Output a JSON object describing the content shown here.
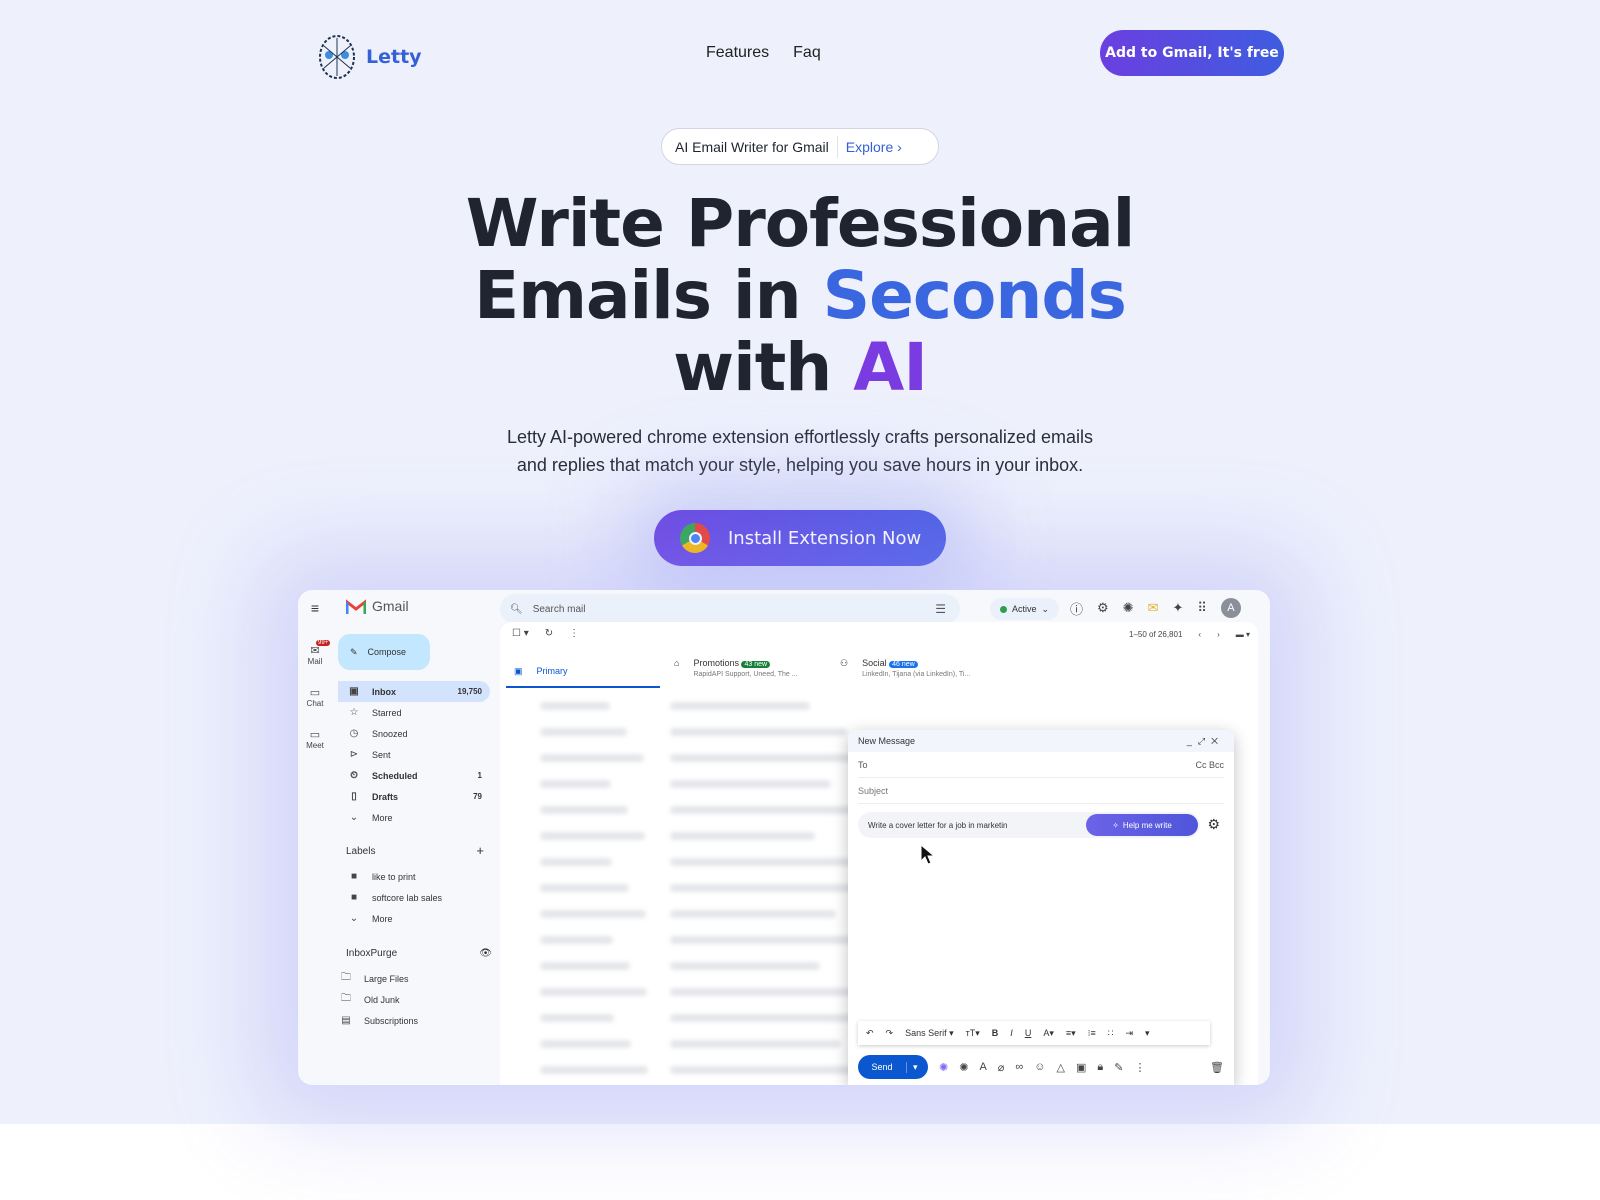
{
  "nav": {
    "brand": "Letty",
    "links": [
      "Features",
      "Faq"
    ],
    "cta": "Add to Gmail, It's free"
  },
  "badge": {
    "text": "AI Email Writer for Gmail",
    "link": "Explore"
  },
  "hero": {
    "line1": "Write Professional",
    "line2a": "Emails in ",
    "line2b": "Seconds",
    "line3a": "with ",
    "line3b": "AI",
    "subtitle_1": "Letty AI-powered chrome extension effortlessly crafts personalized emails",
    "subtitle_2": "and replies that match your style, helping you save hours in your inbox.",
    "install": "Install Extension Now"
  },
  "colors": {
    "accent_blue": "#3a66e0",
    "accent_purple": "#7a3be0",
    "gmail_blue": "#0b57d0"
  },
  "gmail": {
    "app": "Gmail",
    "search_placeholder": "Search mail",
    "status": "Active",
    "avatar": "A",
    "rail": [
      {
        "label": "Mail",
        "badge": "99+"
      },
      {
        "label": "Chat"
      },
      {
        "label": "Meet"
      }
    ],
    "compose": "Compose",
    "folders": [
      {
        "label": "Inbox",
        "count": "19,750",
        "icon": "inbox"
      },
      {
        "label": "Starred",
        "count": "",
        "icon": "☆"
      },
      {
        "label": "Snoozed",
        "count": "",
        "icon": "◷"
      },
      {
        "label": "Sent",
        "count": "",
        "icon": "⊳"
      },
      {
        "label": "Scheduled",
        "count": "1",
        "icon": "⏲"
      },
      {
        "label": "Drafts",
        "count": "79",
        "icon": "▯"
      },
      {
        "label": "More",
        "count": "",
        "icon": "⌄"
      }
    ],
    "labels_title": "Labels",
    "labels": [
      "like to print",
      "softcore lab sales",
      "More"
    ],
    "purge_title": "InboxPurge",
    "purge": [
      "Large Files",
      "Old Junk",
      "Subscriptions"
    ],
    "pagination": "1–50 of 26,801",
    "tabs": [
      {
        "label": "Primary"
      },
      {
        "label": "Promotions",
        "badge": "43 new",
        "sub": "RapidAPI Support, Uneed, The ..."
      },
      {
        "label": "Social",
        "badge": "46 new",
        "sub": "LinkedIn, Tijana (via LinkedIn), Ti..."
      }
    ],
    "message": {
      "title": "New Message",
      "to": "To",
      "ccbcc": "Cc Bcc",
      "subject": "Subject",
      "prompt": "Write a cover letter for a job in marketin",
      "help": "Help me write",
      "font": "Sans Serif",
      "send": "Send"
    }
  }
}
